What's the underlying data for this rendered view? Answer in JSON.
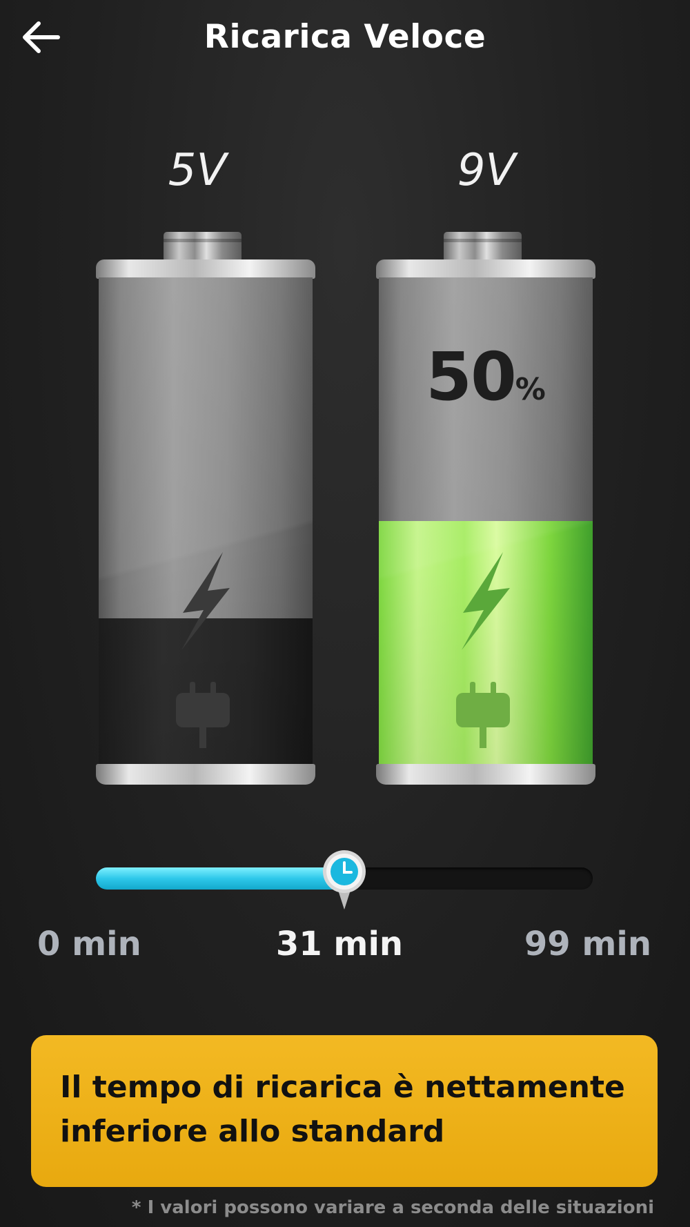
{
  "header": {
    "title": "Ricarica Veloce",
    "back_icon": "arrow-left-icon"
  },
  "batteries": [
    {
      "voltage": "5V",
      "charge_fraction": 0.3,
      "fill_color": "#222222",
      "icons": [
        "lightning-bolt-icon",
        "plug-icon"
      ]
    },
    {
      "voltage": "9V",
      "charge_fraction": 0.5,
      "percent_value": "50",
      "percent_sign": "%",
      "fill_color": "#9ee85a",
      "icons": [
        "lightning-bolt-icon",
        "plug-icon"
      ]
    }
  ],
  "slider": {
    "value_fraction": 0.5,
    "fill_color": "#2ec8ea",
    "thumb_icon": "clock-icon",
    "min_label": "0 min",
    "current_label": "31 min",
    "max_label": "99 min"
  },
  "banner": {
    "text": "Il tempo di ricarica è nettamente inferiore allo standard",
    "color": "#f0b21d"
  },
  "footnote": "* I valori possono variare a seconda delle situazioni"
}
